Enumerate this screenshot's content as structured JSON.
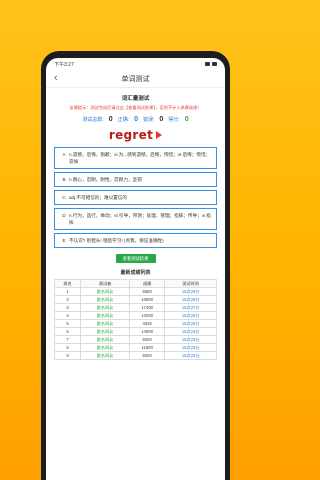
{
  "status": {
    "time": "下午3:27",
    "icons_left": "◎ □ ⊙"
  },
  "nav": {
    "title": "单词测试"
  },
  "quiz": {
    "title": "词汇量测试",
    "hint": "友情提示：测试完成后请点击【查看测试结果】，否则不计入参赛成绩！",
    "stats": [
      {
        "label": "测试总数:",
        "value": "0"
      },
      {
        "label": "正确:",
        "value": "0"
      },
      {
        "label": "错误:",
        "value": "0"
      },
      {
        "label": "得分:",
        "value": "0"
      }
    ],
    "word": "regret",
    "options": [
      {
        "letter": "A",
        "text": "n.遗憾，后悔，抱歉；vi.为...感到遗憾，后悔，惋惜；vt.后悔；惋惜；哀悼"
      },
      {
        "letter": "B",
        "text": "n.耐心，忍耐，耐性，忍耐力，坚韧"
      },
      {
        "letter": "C",
        "text": "adj.不可相信的；难以置信的"
      },
      {
        "letter": "D",
        "text": "n.行为，品行，举动；vt.引导，带领；处理，管理；指挥；传导；vi.指挥"
      },
      {
        "letter": "E",
        "text": "不认识? 别担头! 稍后学习! (点我，保证准确性)"
      }
    ],
    "view_button": "查看测试结果"
  },
  "leaderboard": {
    "title": "最新成绩列表",
    "columns": [
      "排名",
      "测试者",
      "成绩",
      "测试时间"
    ],
    "rows": [
      [
        "1",
        "匿名网友",
        "6650",
        "15点29分"
      ],
      [
        "2",
        "匿名网友",
        "10600",
        "15点28分"
      ],
      [
        "3",
        "匿名网友",
        "17400",
        "15点27分"
      ],
      [
        "4",
        "匿名网友",
        "12000",
        "15点26分"
      ],
      [
        "5",
        "匿名网友",
        "4625",
        "15点25分"
      ],
      [
        "6",
        "匿名网友",
        "14900",
        "15点24分"
      ],
      [
        "7",
        "匿名网友",
        "5000",
        "15点23分"
      ],
      [
        "8",
        "匿名网友",
        "11600",
        "15点23分"
      ],
      [
        "9",
        "匿名网友",
        "5000",
        "15点22分"
      ]
    ]
  }
}
